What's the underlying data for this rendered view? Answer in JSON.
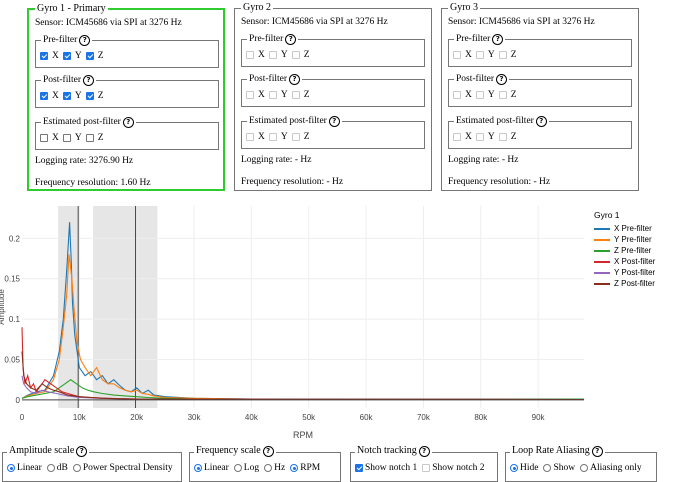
{
  "gyros": [
    {
      "title": "Gyro 1 - Primary",
      "sensor": "Sensor: ICM45686 via SPI at 3276 Hz",
      "prefilter": {
        "label": "Pre-filter",
        "x": true,
        "y": true,
        "z": true,
        "enabled": true
      },
      "postfilter": {
        "label": "Post-filter",
        "x": true,
        "y": true,
        "z": true,
        "enabled": true
      },
      "estimated": {
        "label": "Estimated post-filter",
        "x": false,
        "y": false,
        "z": false,
        "enabled": true
      },
      "logging_rate": "Logging rate: 3276.90 Hz",
      "freq_res": "Frequency resolution: 1.60 Hz"
    },
    {
      "title": "Gyro 2",
      "sensor": "Sensor: ICM45686 via SPI at 3276 Hz",
      "prefilter": {
        "label": "Pre-filter",
        "x": false,
        "y": false,
        "z": false,
        "enabled": false
      },
      "postfilter": {
        "label": "Post-filter",
        "x": false,
        "y": false,
        "z": false,
        "enabled": false
      },
      "estimated": {
        "label": "Estimated post-filter",
        "x": false,
        "y": false,
        "z": false,
        "enabled": false
      },
      "logging_rate": "Logging rate: - Hz",
      "freq_res": "Frequency resolution: - Hz"
    },
    {
      "title": "Gyro 3",
      "sensor": "Sensor: ICM45686 via SPI at 3276 Hz",
      "prefilter": {
        "label": "Pre-filter",
        "x": false,
        "y": false,
        "z": false,
        "enabled": false
      },
      "postfilter": {
        "label": "Post-filter",
        "x": false,
        "y": false,
        "z": false,
        "enabled": false
      },
      "estimated": {
        "label": "Estimated post-filter",
        "x": false,
        "y": false,
        "z": false,
        "enabled": false
      },
      "logging_rate": "Logging rate: - Hz",
      "freq_res": "Frequency resolution: - Hz"
    }
  ],
  "axis_labels": {
    "x": "X",
    "y": "Y",
    "z": "Z"
  },
  "chart_data": {
    "type": "line",
    "xlabel": "RPM",
    "ylabel": "Amplitude",
    "xlim": [
      0,
      98000
    ],
    "ylim": [
      -0.01,
      0.24
    ],
    "x_ticks": [
      0,
      10000,
      20000,
      30000,
      40000,
      50000,
      60000,
      70000,
      80000,
      90000
    ],
    "x_tick_labels": [
      "0",
      "10k",
      "20k",
      "30k",
      "40k",
      "50k",
      "60k",
      "70k",
      "80k",
      "90k"
    ],
    "y_ticks": [
      0,
      0.05,
      0.1,
      0.15,
      0.2
    ],
    "y_tick_labels": [
      "0",
      "0.05",
      "0.1",
      "0.15",
      "0.2"
    ],
    "shaded_regions": [
      [
        6300,
        9800
      ],
      [
        12400,
        23600
      ]
    ],
    "vertical_lines": [
      9800,
      19800
    ],
    "legend_title": "Gyro 1",
    "series": [
      {
        "name": "X Pre-filter",
        "color": "#1f77b4",
        "x": [
          0,
          1000,
          2500,
          4000,
          5500,
          6500,
          7200,
          7800,
          8300,
          8600,
          8800,
          9200,
          9600,
          10000,
          11000,
          12000,
          13000,
          14000,
          15000,
          16000,
          17000,
          18000,
          19000,
          20000,
          21000,
          22000,
          23000,
          25000,
          30000,
          40000,
          60000,
          98000
        ],
        "y": [
          0.002,
          0.006,
          0.01,
          0.012,
          0.03,
          0.06,
          0.1,
          0.16,
          0.22,
          0.17,
          0.12,
          0.08,
          0.06,
          0.04,
          0.03,
          0.035,
          0.025,
          0.03,
          0.02,
          0.025,
          0.018,
          0.012,
          0.01,
          0.015,
          0.008,
          0.012,
          0.006,
          0.004,
          0.002,
          0.001,
          0.001,
          0.001
        ]
      },
      {
        "name": "Y Pre-filter",
        "color": "#ff7f0e",
        "x": [
          0,
          1000,
          2500,
          4000,
          5500,
          6500,
          7200,
          7800,
          8200,
          8700,
          9100,
          9600,
          10200,
          11000,
          12000,
          13000,
          14000,
          15000,
          16000,
          17000,
          18000,
          19000,
          20000,
          21000,
          22000,
          23000,
          25000,
          30000,
          40000,
          60000,
          98000
        ],
        "y": [
          0.002,
          0.005,
          0.008,
          0.01,
          0.025,
          0.05,
          0.09,
          0.13,
          0.18,
          0.15,
          0.11,
          0.07,
          0.05,
          0.04,
          0.03,
          0.04,
          0.025,
          0.02,
          0.02,
          0.015,
          0.012,
          0.01,
          0.012,
          0.008,
          0.007,
          0.005,
          0.003,
          0.002,
          0.001,
          0.001,
          0.001
        ]
      },
      {
        "name": "Z Pre-filter",
        "color": "#2ca02c",
        "x": [
          0,
          1000,
          2500,
          4000,
          5500,
          6500,
          7500,
          8500,
          9500,
          10500,
          11500,
          12500,
          14000,
          16000,
          18000,
          20000,
          22000,
          25000,
          30000,
          40000,
          60000,
          98000
        ],
        "y": [
          0.002,
          0.004,
          0.006,
          0.008,
          0.01,
          0.015,
          0.02,
          0.025,
          0.02,
          0.015,
          0.012,
          0.01,
          0.008,
          0.006,
          0.005,
          0.004,
          0.003,
          0.002,
          0.001,
          0.001,
          0.001,
          0.001
        ]
      },
      {
        "name": "X Post-filter",
        "color": "#d62728",
        "x": [
          0,
          200,
          500,
          1000,
          1500,
          2000,
          2500,
          3000,
          4000,
          5000,
          6000,
          7000,
          8000,
          9000,
          10000,
          12000,
          15000,
          20000,
          30000,
          98000
        ],
        "y": [
          0.09,
          0.04,
          0.02,
          0.03,
          0.015,
          0.02,
          0.01,
          0.015,
          0.025,
          0.02,
          0.015,
          0.01,
          0.008,
          0.006,
          0.004,
          0.003,
          0.002,
          0.001,
          0.001,
          0.0005
        ]
      },
      {
        "name": "Y Post-filter",
        "color": "#9467bd",
        "x": [
          0,
          300,
          800,
          1500,
          2500,
          3500,
          4500,
          6000,
          8000,
          10000,
          14000,
          20000,
          30000,
          98000
        ],
        "y": [
          0.03,
          0.02,
          0.015,
          0.01,
          0.008,
          0.012,
          0.01,
          0.008,
          0.005,
          0.003,
          0.002,
          0.001,
          0.001,
          0.0005
        ]
      },
      {
        "name": "Z Post-filter",
        "color": "#8c2d19",
        "x": [
          0,
          300,
          800,
          1500,
          2500,
          3500,
          4500,
          5500,
          6500,
          8000,
          10000,
          14000,
          20000,
          30000,
          98000
        ],
        "y": [
          0.06,
          0.03,
          0.02,
          0.015,
          0.012,
          0.02,
          0.015,
          0.012,
          0.01,
          0.006,
          0.004,
          0.002,
          0.001,
          0.001,
          0.0005
        ]
      }
    ]
  },
  "controls": {
    "amplitude": {
      "title": "Amplitude scale",
      "options": [
        "Linear",
        "dB",
        "Power Spectral Density"
      ],
      "selected": 0
    },
    "frequency": {
      "title": "Frequency scale",
      "options": [
        "Linear",
        "Log",
        "Hz",
        "RPM"
      ],
      "selected_scale": 0,
      "selected_unit": 3
    },
    "notch": {
      "title": "Notch tracking",
      "options": [
        "Show notch 1",
        "Show notch 2"
      ],
      "checked": [
        true,
        false
      ]
    },
    "aliasing": {
      "title": "Loop Rate Aliasing",
      "options": [
        "Hide",
        "Show",
        "Aliasing only"
      ],
      "selected": 0
    }
  }
}
